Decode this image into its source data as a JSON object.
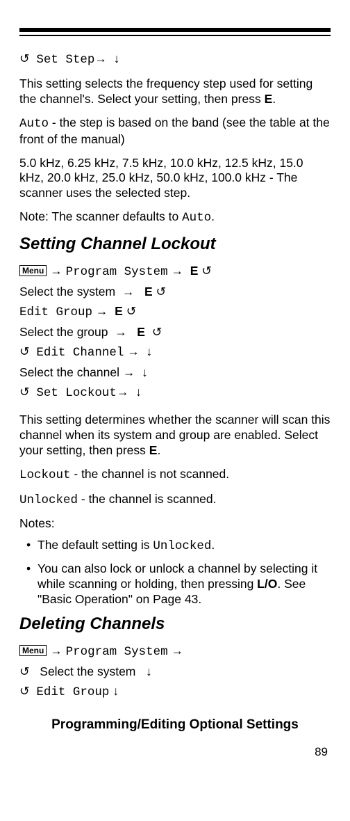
{
  "top": {
    "setStepLine": {
      "refresh": "↺",
      "label": "Set Step",
      "arrow": "→",
      "down": "↓"
    },
    "para1a": "This setting selects the frequency step used for setting the channel's. Select your setting, then press ",
    "para1b": "E",
    "para1c": ".",
    "autoLabel": "Auto",
    "autoRest": " - the step is based on the band (see the table at the front of the manual)",
    "stepsPara": "5.0 kHz, 6.25 kHz, 7.5 kHz, 10.0 kHz, 12.5 kHz, 15.0 kHz, 20.0 kHz, 25.0 kHz, 50.0 kHz, 100.0 kHz - The scanner uses the selected step.",
    "notePrefix": "Note: The scanner defaults to ",
    "noteAuto": "Auto",
    "noteSuffix": "."
  },
  "lockout": {
    "heading": "Setting Channel Lockout",
    "menuLabel": "Menu",
    "arrow": "→",
    "progSys": "Program System",
    "E": "E",
    "refresh": "↺",
    "selSystem": "Select the system",
    "editGroup": "Edit Group",
    "selGroup": "Select the group",
    "editChannel": "Edit Channel",
    "down": "↓",
    "selChannel": "Select the channel",
    "setLockout": "Set Lockout",
    "para1a": "This setting determines whether the scanner will scan this channel when its system and group are enabled. Select your setting, then press ",
    "para1b": "E",
    "para1c": ".",
    "lockoutLabel": "Lockout",
    "lockoutRest": " - the channel is not scanned.",
    "unlockedLabel": "Unlocked",
    "unlockedRest": " - the channel is scanned.",
    "notesLabel": "Notes:",
    "note1a": "The default setting is ",
    "note1b": "Unlocked",
    "note1c": ".",
    "note2a": "You can also lock or unlock a channel by selecting it while scanning or holding, then pressing ",
    "note2b": "L/O",
    "note2c": ". See \"Basic Operation\" on Page 43."
  },
  "deleting": {
    "heading": "Deleting Channels",
    "menuLabel": "Menu",
    "arrow": "→",
    "progSys": "Program System",
    "refresh": "↺",
    "selSystem": "Select the system",
    "down": "↓",
    "editGroup": "Edit Group"
  },
  "footer": {
    "title": "Programming/Editing Optional Settings",
    "pageNum": "89"
  }
}
